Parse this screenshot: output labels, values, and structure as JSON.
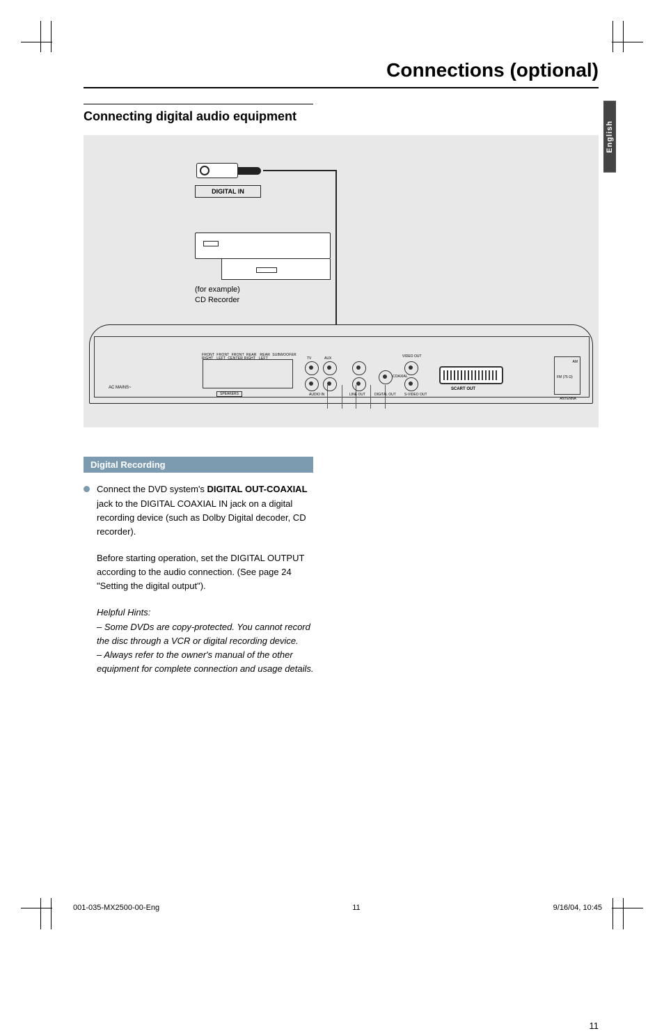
{
  "page": {
    "title": "Connections (optional)",
    "language_tab": "English",
    "page_number": "11"
  },
  "section": {
    "heading": "Connecting digital audio equipment",
    "sub_heading": "Digital Recording"
  },
  "diagram": {
    "cable_label": "DIGITAL IN",
    "example_line1": "(for example)",
    "example_line2": "CD Recorder",
    "rear_panel": {
      "ac_mains": "AC MAINS~",
      "speaker_top_row": "FRONT  FRONT  FRONT  REAR   REAR  SUBWOOFER",
      "speaker_bottom_row": "RIGHT   LEFT  CENTER RIGHT   LEFT",
      "speakers_badge": "SPEAKERS",
      "tv": "TV",
      "aux": "AUX",
      "audio_in": "AUDIO IN",
      "line_out": "LINE OUT",
      "digital_out": "DIGITAL OUT",
      "coaxial": "COAXIAL",
      "video_out": "VIDEO OUT",
      "svideo_out": "S-VIDEO OUT",
      "scart_out": "SCART OUT",
      "antenna": "ANTENNA",
      "am": "AM",
      "fm": "FM (75 Ω)"
    }
  },
  "body": {
    "p1_pre": "Connect the DVD system's ",
    "p1_bold": "DIGITAL OUT-COAXIAL",
    "p1_post": " jack to the DIGITAL COAXIAL IN jack on a digital recording device (such as Dolby Digital decoder, CD recorder).",
    "p2": "Before starting operation, set the DIGITAL OUTPUT according to the audio connection. (See page 24 \"Setting the digital output\").",
    "hints_title": "Helpful Hints:",
    "hint1": "–   Some DVDs are copy-protected.  You cannot record the disc through a VCR or digital recording device.",
    "hint2": "–   Always refer to the owner's manual of the other equipment for complete connection and usage details."
  },
  "footer": {
    "left": "001-035-MX2500-00-Eng",
    "center": "11",
    "right": "9/16/04, 10:45"
  }
}
